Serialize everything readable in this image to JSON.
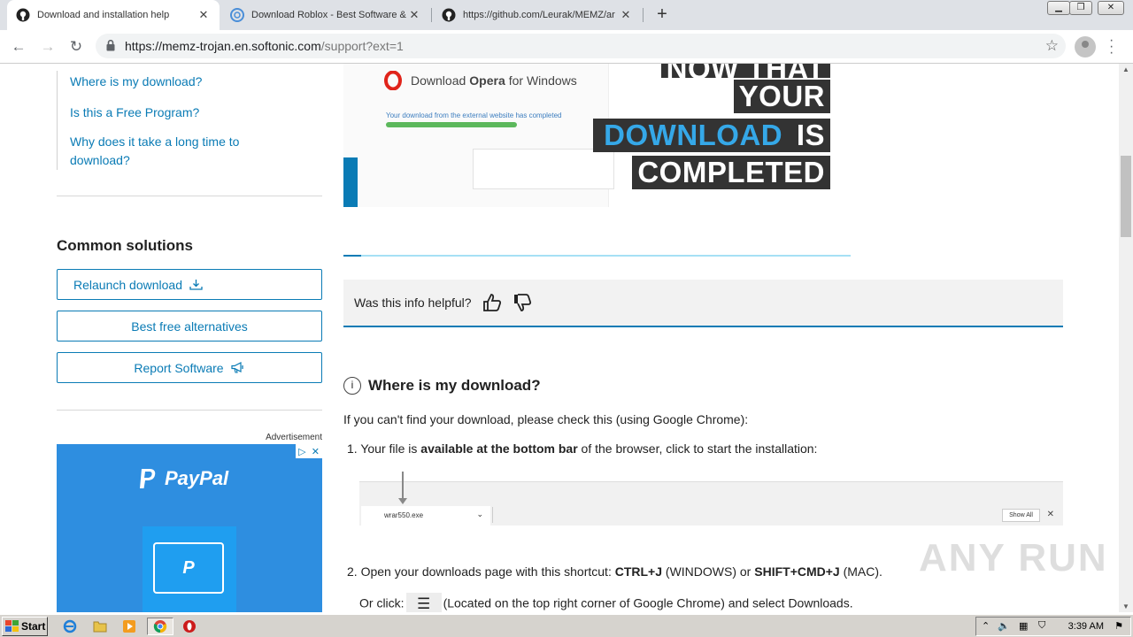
{
  "browser": {
    "tabs": [
      {
        "title": "Download and installation help",
        "active": true
      },
      {
        "title": "Download Roblox - Best Software &",
        "active": false
      },
      {
        "title": "https://github.com/Leurak/MEMZ/ar",
        "active": false
      }
    ],
    "url_host": "https://memz-trojan.en.softonic.com",
    "url_path": "/support?ext=1"
  },
  "sidebar": {
    "links": [
      "Where is my download?",
      "Is this a Free Program?",
      "Why does it take a long time to download?"
    ],
    "common_title": "Common solutions",
    "buttons": [
      "Relaunch download",
      "Best free alternatives",
      "Report Software"
    ],
    "ad_label": "Advertisement",
    "ad_brand": "PayPal"
  },
  "hero": {
    "app_text": "Download",
    "app_name": "Opera",
    "app_suffix": "for Windows",
    "progress_text": "Your download from the external website has completed",
    "lines": [
      "NOW THAT",
      "YOUR",
      "DOWNLOAD",
      "IS",
      "COMPLETED"
    ]
  },
  "feedback": {
    "question": "Was this info helpful?"
  },
  "section": {
    "title": "Where is my download?",
    "intro": "If you can't find your download, please check this (using Google Chrome):",
    "step1_prefix": "1. Your file is ",
    "step1_bold": "available at the bottom bar",
    "step1_suffix": " of the browser, click to start the installation:",
    "dl_filename": "wrar550.exe",
    "dl_showall": "Show All",
    "step2_prefix": "2. Open your downloads page with this shortcut: ",
    "step2_k1": "CTRL+J",
    "step2_mid": " (WINDOWS) or ",
    "step2_k2": "SHIFT+CMD+J",
    "step2_suffix": " (MAC).",
    "step3_prefix": "Or click:",
    "step3_suffix": "(Located on the top right corner of Google Chrome) and select Downloads."
  },
  "watermark": "ANY RUN",
  "taskbar": {
    "start": "Start",
    "clock": "3:39 AM"
  }
}
